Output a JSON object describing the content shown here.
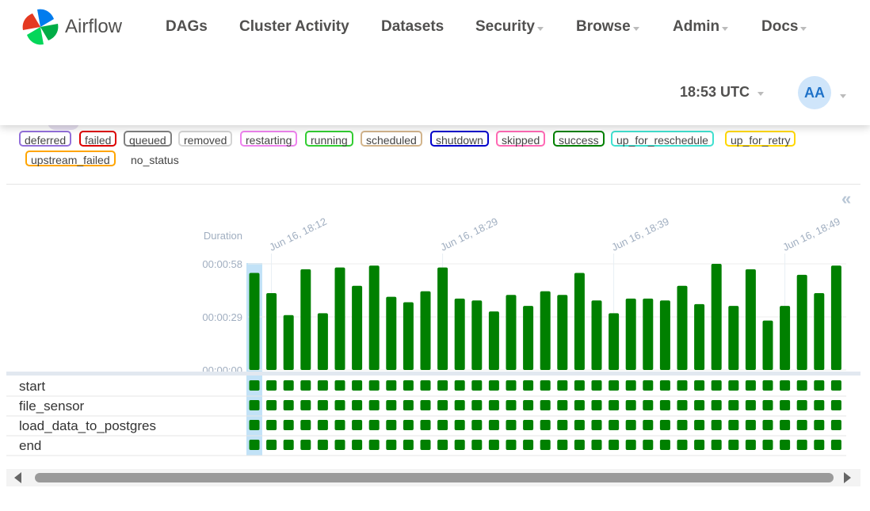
{
  "app": {
    "name": "Airflow"
  },
  "nav": [
    {
      "label": "DAGs",
      "dropdown": false
    },
    {
      "label": "Cluster Activity",
      "dropdown": false
    },
    {
      "label": "Datasets",
      "dropdown": false
    },
    {
      "label": "Security",
      "dropdown": true
    },
    {
      "label": "Browse",
      "dropdown": true
    },
    {
      "label": "Admin",
      "dropdown": true
    },
    {
      "label": "Docs",
      "dropdown": true
    }
  ],
  "clock": {
    "time": "18:53 UTC"
  },
  "user": {
    "initials": "AA"
  },
  "legend": [
    {
      "label": "deferred",
      "color": "#9370db"
    },
    {
      "label": "failed",
      "color": "#dd0000"
    },
    {
      "label": "queued",
      "color": "#808080"
    },
    {
      "label": "removed",
      "color": "#d3d3d3"
    },
    {
      "label": "restarting",
      "color": "#ee82ee"
    },
    {
      "label": "running",
      "color": "#32cd32"
    },
    {
      "label": "scheduled",
      "color": "#d2b48c"
    },
    {
      "label": "shutdown",
      "color": "#0000cc"
    },
    {
      "label": "skipped",
      "color": "#ff69b4"
    },
    {
      "label": "success",
      "color": "#008000"
    },
    {
      "label": "up_for_reschedule",
      "color": "#40e0d0"
    },
    {
      "label": "up_for_retry",
      "color": "#ffd700"
    },
    {
      "label": "upstream_failed",
      "color": "#ffa500"
    },
    {
      "label": "no_status",
      "color": ""
    }
  ],
  "chart_data": {
    "type": "bar",
    "ylabel": "Duration",
    "y_ticks": [
      "00:00:58",
      "00:00:29",
      "00:00:00"
    ],
    "ylim_seconds": [
      0,
      58
    ],
    "x_ticks": [
      {
        "label": "Jun 16, 18:12",
        "run_index": 1
      },
      {
        "label": "Jun 16, 18:29",
        "run_index": 11
      },
      {
        "label": "Jun 16, 18:39",
        "run_index": 21
      },
      {
        "label": "Jun 16, 18:49",
        "run_index": 31
      }
    ],
    "series": [
      {
        "state": "success",
        "values": [
          53,
          42,
          30,
          55,
          31,
          56,
          46,
          57,
          40,
          37,
          43,
          56,
          39,
          38,
          32,
          41,
          35,
          43,
          41,
          53,
          38,
          31,
          39,
          39,
          38,
          46,
          36,
          58,
          35,
          55,
          27,
          35,
          52,
          42,
          57
        ]
      }
    ],
    "selected_run_index": 0,
    "tasks": [
      {
        "name": "start",
        "state": "success"
      },
      {
        "name": "file_sensor",
        "state": "success"
      },
      {
        "name": "load_data_to_postgres",
        "state": "success"
      },
      {
        "name": "end",
        "state": "success"
      }
    ],
    "colors": {
      "success": "#008000",
      "selected": "#c2e2f7",
      "axis_text": "#a0aec0"
    }
  }
}
